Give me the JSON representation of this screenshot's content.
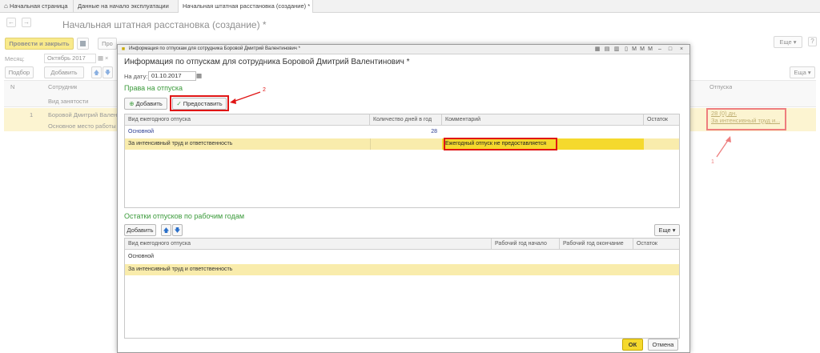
{
  "tabs": [
    {
      "label": "Начальная страница"
    },
    {
      "label": "Данные на начало эксплуатации"
    },
    {
      "label": "Начальная штатная расстановка (создание) *"
    }
  ],
  "form": {
    "title": "Начальная штатная расстановка (создание) *",
    "post_close_label": "Провести и закрыть",
    "post_label": "Про",
    "more_label": "Еще",
    "more_label2": "Еща",
    "month_label": "Месяц:",
    "month_value": "Октябрь 2017",
    "pick_label": "Подбор",
    "add_label": "Добавить",
    "columns": {
      "n": "N",
      "employee": "Сотрудник",
      "employment_type": "Вид занятости",
      "leaves": "Отпуска"
    },
    "row": {
      "n": "1",
      "employee": "Боровой Дмитрий Валентин",
      "employment_type": "Основное место работы",
      "leave_days": "28 (0) дн.",
      "leave_type": "За интенсивный труд и..."
    }
  },
  "dialog": {
    "window_title": "Информация по отпускам для сотрудника Боровой Дмитрий Валентинович *",
    "heading": "Информация по отпускам для сотрудника Боровой Дмитрий Валентинович *",
    "date_label": "На дату:",
    "date_value": "01.10.2017",
    "rights": {
      "title": "Права на отпуска",
      "add_label": "Добавить",
      "grant_label": "Предоставить",
      "columns": {
        "type": "Вид ежегодного отпуска",
        "days": "Количество дней в год",
        "comment": "Комментарий",
        "rest": "Остаток"
      },
      "rows": [
        {
          "type": "Основной",
          "days": "28",
          "comment": "",
          "rest": ""
        },
        {
          "type": "За интенсивный труд и ответственность",
          "days": "",
          "comment": "Ежегодный отпуск не предоставляется",
          "rest": ""
        }
      ]
    },
    "balances": {
      "title": "Остатки отпусков по рабочим годам",
      "add_label": "Добавить",
      "more_label": "Еще",
      "columns": {
        "type": "Вид ежегодного отпуска",
        "start": "Рабочий год начало",
        "end": "Рабочий год окончание",
        "rest": "Остаток"
      },
      "rows": [
        {
          "type": "Основной"
        },
        {
          "type": "За интенсивный труд и ответственность"
        }
      ]
    },
    "ok_label": "ОК",
    "cancel_label": "Отмена"
  },
  "annotations": {
    "one": "1",
    "two": "2"
  },
  "colors": {
    "accent_yellow": "#f5d92d",
    "selected_row": "#f9ecac",
    "annotation_red": "#e01515",
    "section_green": "#3a9a3a"
  }
}
